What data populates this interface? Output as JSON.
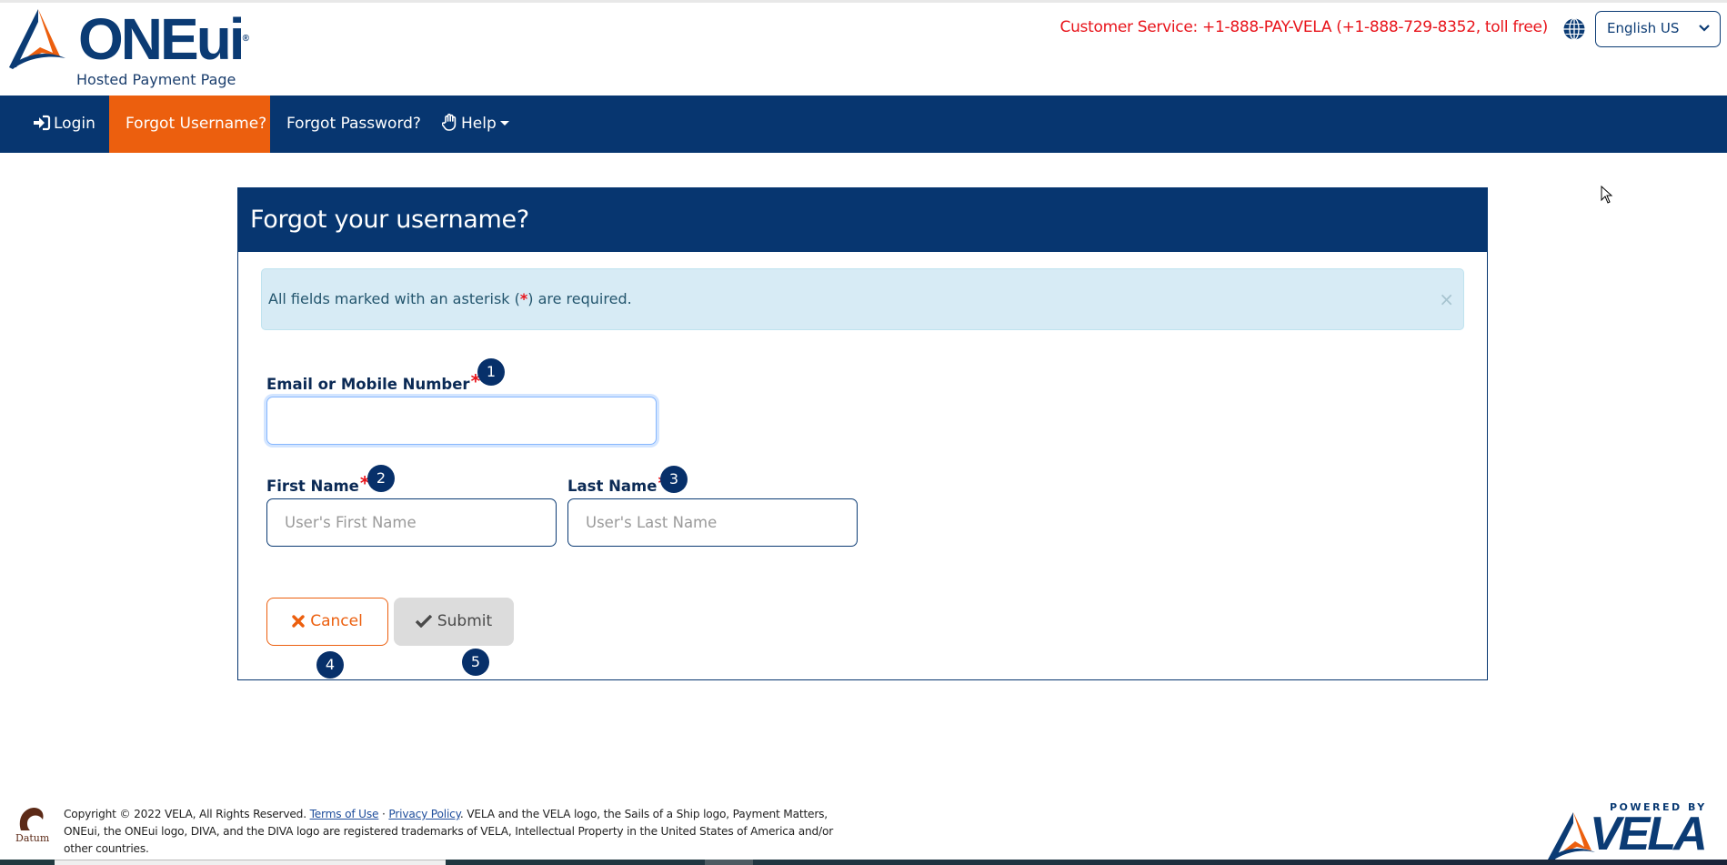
{
  "header": {
    "logo_brand": "ONEui",
    "logo_subtitle": "Hosted Payment Page",
    "customer_service": "Customer Service: +1-888-PAY-VELA (+1-888-729-8352, toll free)",
    "language_icon": "globe-icon",
    "language_selected": "English US"
  },
  "nav": {
    "items": [
      {
        "label": "Login",
        "icon": "sign-in-icon",
        "active": false
      },
      {
        "label": "Forgot Username?",
        "active": true
      },
      {
        "label": "Forgot Password?",
        "active": false
      },
      {
        "label": "Help",
        "icon": "hand-paper-icon",
        "dropdown": true,
        "active": false
      }
    ]
  },
  "card": {
    "title": "Forgot your username?",
    "alert": {
      "text_before": "All fields marked with an asterisk (",
      "asterisk": "*",
      "text_after": ") are required.",
      "close": "×"
    },
    "fields": {
      "email": {
        "label": "Email or Mobile Number",
        "required_mark": "*",
        "value": "",
        "placeholder": "",
        "badge": "1"
      },
      "first_name": {
        "label": "First Name",
        "required_mark": "*",
        "value": "",
        "placeholder": "User's First Name",
        "badge": "2"
      },
      "last_name": {
        "label": "Last Name",
        "required_mark": "*",
        "value": "",
        "placeholder": "User's Last Name",
        "badge": "3"
      }
    },
    "buttons": {
      "cancel": {
        "label": "Cancel",
        "icon": "times-icon",
        "badge": "4"
      },
      "submit": {
        "label": "Submit",
        "icon": "check-icon",
        "badge": "5"
      }
    }
  },
  "footer": {
    "logo_text": "Datum",
    "copyright": "Copyright © 2022 VELA, All Rights Reserved.",
    "terms_link": "Terms of Use",
    "separator": "·",
    "privacy_link": "Privacy Policy",
    "trademark_text": ". VELA and the VELA logo, the Sails of a Ship logo, Payment Matters, ONEui, the ONEui logo, DIVA, and the DIVA logo are registered trademarks of VELA, Intellectual Property in the United States of America and/or other countries.",
    "powered_by": "POWERED BY",
    "powered_brand": "VELA"
  },
  "colors": {
    "primary": "#073670",
    "accent": "#ec5f0e",
    "required": "#e8141b",
    "alert_bg": "#d7ebf5"
  }
}
